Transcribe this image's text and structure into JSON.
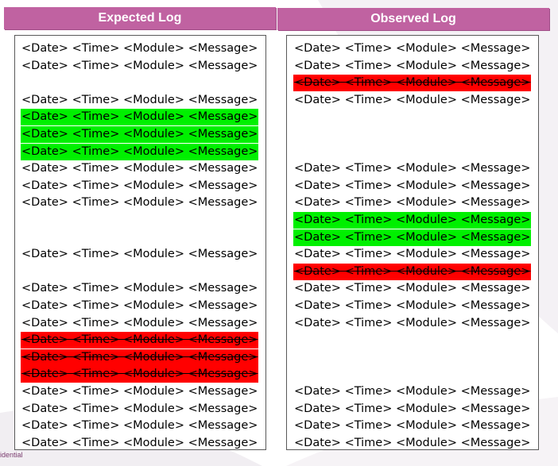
{
  "headers": {
    "expected": "Expected Log",
    "observed": "Observed Log"
  },
  "footer": {
    "text": "idential"
  },
  "log_entry_text": "<Date> <Time> <Module> <Message>",
  "expected_log": [
    {
      "text": "<Date> <Time> <Module> <Message>",
      "status": "normal"
    },
    {
      "text": "<Date> <Time> <Module> <Message>",
      "status": "normal"
    },
    {
      "text": "",
      "status": "blank"
    },
    {
      "text": "<Date> <Time> <Module> <Message>",
      "status": "normal"
    },
    {
      "text": "<Date> <Time> <Module> <Message>",
      "status": "added"
    },
    {
      "text": "<Date> <Time> <Module> <Message>",
      "status": "added"
    },
    {
      "text": "<Date> <Time> <Module> <Message>",
      "status": "added"
    },
    {
      "text": "<Date> <Time> <Module> <Message>",
      "status": "normal"
    },
    {
      "text": "<Date> <Time> <Module> <Message>",
      "status": "normal"
    },
    {
      "text": "<Date> <Time> <Module> <Message>",
      "status": "normal"
    },
    {
      "text": "",
      "status": "blank"
    },
    {
      "text": "",
      "status": "blank"
    },
    {
      "text": "<Date> <Time> <Module> <Message>",
      "status": "normal"
    },
    {
      "text": "",
      "status": "blank"
    },
    {
      "text": "<Date> <Time> <Module> <Message>",
      "status": "normal"
    },
    {
      "text": "<Date> <Time> <Module> <Message>",
      "status": "normal"
    },
    {
      "text": "<Date> <Time> <Module> <Message>",
      "status": "normal"
    },
    {
      "text": "<Date> <Time> <Module> <Message>",
      "status": "removed"
    },
    {
      "text": "<Date> <Time> <Module> <Message>",
      "status": "removed"
    },
    {
      "text": "<Date> <Time> <Module> <Message>",
      "status": "removed"
    },
    {
      "text": "<Date> <Time> <Module> <Message>",
      "status": "normal"
    },
    {
      "text": "<Date> <Time> <Module> <Message>",
      "status": "normal"
    },
    {
      "text": "<Date> <Time> <Module> <Message>",
      "status": "normal"
    },
    {
      "text": "<Date> <Time> <Module> <Message>",
      "status": "normal"
    }
  ],
  "observed_log": [
    {
      "text": "<Date> <Time> <Module> <Message>",
      "status": "normal"
    },
    {
      "text": "<Date> <Time> <Module> <Message>",
      "status": "normal"
    },
    {
      "text": "<Date> <Time> <Module> <Message>",
      "status": "removed"
    },
    {
      "text": "<Date> <Time> <Module> <Message>",
      "status": "normal"
    },
    {
      "text": "",
      "status": "blank"
    },
    {
      "text": "",
      "status": "blank"
    },
    {
      "text": "",
      "status": "blank"
    },
    {
      "text": "<Date> <Time> <Module> <Message>",
      "status": "normal"
    },
    {
      "text": "<Date> <Time> <Module> <Message>",
      "status": "normal"
    },
    {
      "text": "<Date> <Time> <Module> <Message>",
      "status": "normal"
    },
    {
      "text": "<Date> <Time> <Module> <Message>",
      "status": "added"
    },
    {
      "text": "<Date> <Time> <Module> <Message>",
      "status": "added"
    },
    {
      "text": "<Date> <Time> <Module> <Message>",
      "status": "normal"
    },
    {
      "text": "<Date> <Time> <Module> <Message>",
      "status": "removed"
    },
    {
      "text": "<Date> <Time> <Module> <Message>",
      "status": "normal"
    },
    {
      "text": "<Date> <Time> <Module> <Message>",
      "status": "normal"
    },
    {
      "text": "<Date> <Time> <Module> <Message>",
      "status": "normal"
    },
    {
      "text": "",
      "status": "blank"
    },
    {
      "text": "",
      "status": "blank"
    },
    {
      "text": "",
      "status": "blank"
    },
    {
      "text": "<Date> <Time> <Module> <Message>",
      "status": "normal"
    },
    {
      "text": "<Date> <Time> <Module> <Message>",
      "status": "normal"
    },
    {
      "text": "<Date> <Time> <Module> <Message>",
      "status": "normal"
    },
    {
      "text": "<Date> <Time> <Module> <Message>",
      "status": "normal"
    }
  ],
  "colors": {
    "header_bg": "#c062a1",
    "added_highlight": "#00f000",
    "removed_highlight": "#ff0000"
  }
}
